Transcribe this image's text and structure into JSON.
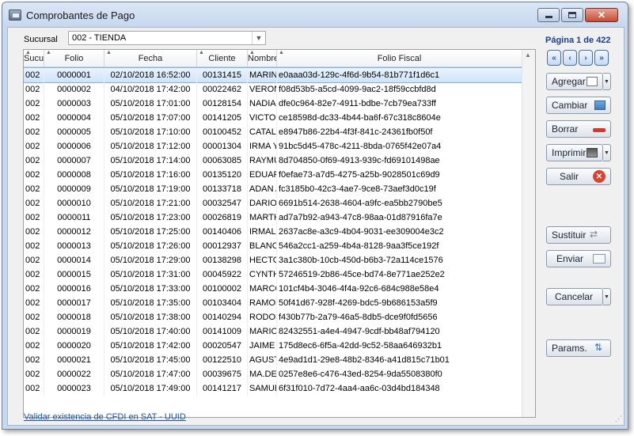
{
  "window": {
    "title": "Comprobantes de Pago",
    "close_glyph": "✕"
  },
  "filter": {
    "sucursal_label": "Sucursal",
    "sucursal_value": "002 - TIENDA"
  },
  "pager": {
    "label": "Página 1 de 422",
    "first": "«",
    "prev": "‹",
    "next": "›",
    "last": "»"
  },
  "table": {
    "headers": [
      "Sucur",
      "Folio",
      "Fecha",
      "Cliente",
      "Nombre",
      "Folio Fiscal"
    ],
    "rows": [
      [
        "002",
        "0000001",
        "02/10/2018 16:52:00",
        "00131415",
        "MARINA",
        "e0aaa03d-129c-4f6d-9b54-81b771f1d6c1"
      ],
      [
        "002",
        "0000002",
        "04/10/2018 17:42:00",
        "00022462",
        "VERONI",
        "f08d53b5-a5cd-4099-9ac2-18f59ccbfd8d"
      ],
      [
        "002",
        "0000003",
        "05/10/2018 17:01:00",
        "00128154",
        "NADIA",
        "dfe0c964-82e7-4911-bdbe-7cb79ea733ff"
      ],
      [
        "002",
        "0000004",
        "05/10/2018 17:07:00",
        "00141205",
        "VICTOF",
        "ce18598d-dc33-4b44-ba6f-67c318c8604e"
      ],
      [
        "002",
        "0000005",
        "05/10/2018 17:10:00",
        "00100452",
        "CATALI",
        "e8947b86-22b4-4f3f-841c-24361fb0f50f"
      ],
      [
        "002",
        "0000006",
        "05/10/2018 17:12:00",
        "00001304",
        "IRMA Y",
        "91bc5d45-478c-4211-8bda-0765f42e07a4"
      ],
      [
        "002",
        "0000007",
        "05/10/2018 17:14:00",
        "00063085",
        "RAYMU",
        "8d704850-0f69-4913-939c-fd69101498ae"
      ],
      [
        "002",
        "0000008",
        "05/10/2018 17:16:00",
        "00135120",
        "EDUAR",
        "f0efae73-a7d5-4275-a25b-9028501c69d9"
      ],
      [
        "002",
        "0000009",
        "05/10/2018 17:19:00",
        "00133718",
        "ADAN A",
        "fc3185b0-42c3-4ae7-9ce8-73aef3d0c19f"
      ],
      [
        "002",
        "0000010",
        "05/10/2018 17:21:00",
        "00032547",
        "DARIO",
        "6691b514-2638-4604-a9fc-ea5bb2790be5"
      ],
      [
        "002",
        "0000011",
        "05/10/2018 17:23:00",
        "00026819",
        "MARTH",
        "ad7a7b92-a943-47c8-98aa-01d87916fa7e"
      ],
      [
        "002",
        "0000012",
        "05/10/2018 17:25:00",
        "00140406",
        "IRMAL",
        "2637ac8e-a3c9-4b04-9031-ee309004e3c2"
      ],
      [
        "002",
        "0000013",
        "05/10/2018 17:26:00",
        "00012937",
        "BLANC",
        "546a2cc1-a259-4b4a-8128-9aa3f5ce192f"
      ],
      [
        "002",
        "0000014",
        "05/10/2018 17:29:00",
        "00138298",
        "HECTO",
        "3a1c380b-10cb-450d-b6b3-72a114ce1576"
      ],
      [
        "002",
        "0000015",
        "05/10/2018 17:31:00",
        "00045922",
        "CYNTH",
        "57246519-2b86-45ce-bd74-8e771ae252e2"
      ],
      [
        "002",
        "0000016",
        "05/10/2018 17:33:00",
        "00100002",
        "MARCO",
        "101cf4b4-3046-4f4a-92c6-684c988e58e4"
      ],
      [
        "002",
        "0000017",
        "05/10/2018 17:35:00",
        "00103404",
        "RAMON",
        "50f41d67-928f-4269-bdc5-9b686153a5f9"
      ],
      [
        "002",
        "0000018",
        "05/10/2018 17:38:00",
        "00140294",
        "RODOL",
        "f430b77b-2a79-46a5-8db5-dce9f0fd5656"
      ],
      [
        "002",
        "0000019",
        "05/10/2018 17:40:00",
        "00141009",
        "MARIO",
        "82432551-a4e4-4947-9cdf-bb48af794120"
      ],
      [
        "002",
        "0000020",
        "05/10/2018 17:42:00",
        "00020547",
        "JAIME .",
        "175d8ec6-6f5a-42dd-9c52-58aa646932b1"
      ],
      [
        "002",
        "0000021",
        "05/10/2018 17:45:00",
        "00122510",
        "AGUSTI",
        "4e9ad1d1-29e8-48b2-8346-a41d815c71b01"
      ],
      [
        "002",
        "0000022",
        "05/10/2018 17:47:00",
        "00039675",
        "MA.DE",
        "0257e8e6-c476-43ed-8254-9da5508380f0"
      ],
      [
        "002",
        "0000023",
        "05/10/2018 17:49:00",
        "00141217",
        "SAMUE",
        "6f31f010-7d72-4aa4-aa6c-03d4bd184348"
      ]
    ]
  },
  "actions": {
    "agregar": "Agregar",
    "cambiar": "Cambiar",
    "borrar": "Borrar",
    "imprimir": "Imprimir",
    "salir": "Salir",
    "sustituir": "Sustituir",
    "enviar": "Enviar",
    "cancelar": "Cancelar",
    "params": "Params."
  },
  "footer": {
    "link": "Validar existencia de CFDI en SAT - UUID"
  }
}
